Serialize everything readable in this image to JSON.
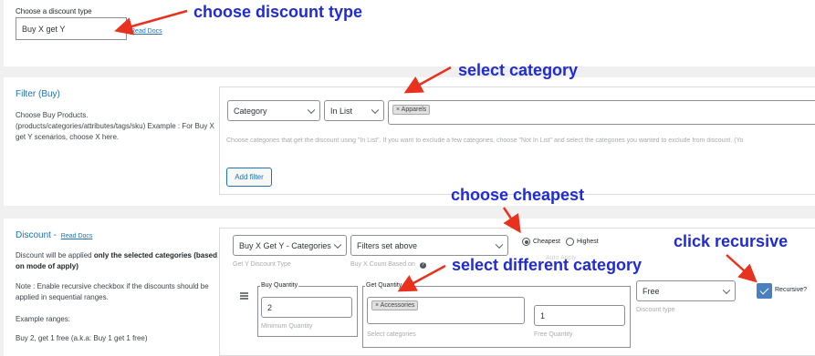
{
  "discount_type": {
    "label": "Choose a discount type",
    "value": "Buy X get Y",
    "read_docs": "Read Docs"
  },
  "filter": {
    "title": "Filter (Buy)",
    "description": "Choose Buy Products. (products/categories/attributes/tags/sku) Example : For Buy X get Y scenarios, choose X here.",
    "type_select": "Category",
    "method_select": "In List",
    "selected_tag": "× Apparels",
    "help": "Choose categories that get the discount using \"In List\". If you want to exclude a few categories, choose \"Not In List\" and select the categories you wanted to exclude from discount. (Yo",
    "add_filter": "Add filter"
  },
  "discount": {
    "title": "Discount -",
    "read_docs": "Read Docs",
    "desc_plain": "Discount will be applied ",
    "desc_bold": "only the selected categories (based on mode of apply)",
    "note": "Note : Enable recursive checkbox if the discounts should be applied in sequential ranges.",
    "example_ranges": "Example ranges:",
    "example_1": "Buy 2, get 1 free (a.k.a: Buy 1 get 1 free)",
    "type_select": "Buy X Get Y - Categories",
    "type_caption": "Get Y Discount Type",
    "count_select": "Filters set above",
    "count_caption": "Buy X Count Based on",
    "radio_cheapest": "Cheapest",
    "radio_highest": "Highest",
    "auto_apply_caption": "Auto Apply",
    "buy_quantity_legend": "Buy Quantity",
    "buy_quantity_value": "2",
    "buy_quantity_caption": "Minimum Quantity",
    "get_quantity_legend": "Get Quantity",
    "get_tag": "× Accessories",
    "get_caption": "Select categories",
    "free_quantity_value": "1",
    "free_quantity_caption": "Free Quantity",
    "discount_type_select": "Free",
    "discount_type_caption": "Discount type",
    "recursive_label": "Recursive?",
    "recursive_checked": true
  },
  "annotations": {
    "a1": "choose discount type",
    "a2": "select category",
    "a3": "choose cheapest",
    "a4": "click recursive",
    "a5": "select different category"
  },
  "colors": {
    "annotation_text": "#1f2bd6",
    "arrow": "#e8321e",
    "link": "#2271b1",
    "checkbox": "#4a7fc1"
  }
}
